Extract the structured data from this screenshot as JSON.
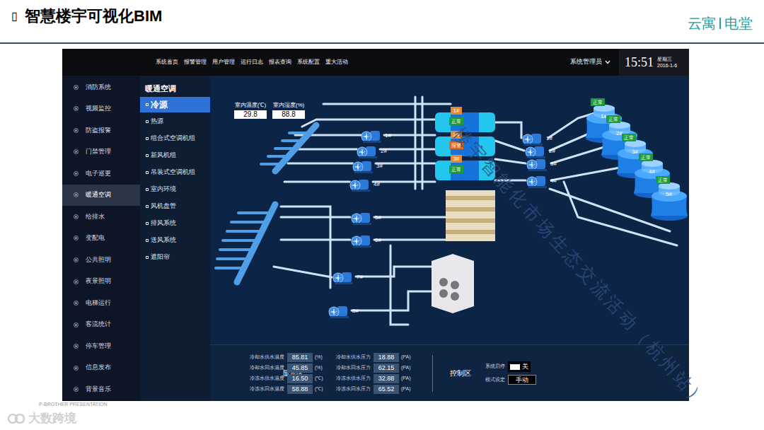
{
  "slide": {
    "title_icon": "▯",
    "title": "智慧楼宇可视化BIM",
    "brand": [
      "云寓",
      "电堂"
    ],
    "credit": "P-BROTHER PRESENTATION",
    "logo_text": "大数跨境",
    "watermark": "楼宇智能化市场生态交流活动（杭州站）"
  },
  "app": {
    "nav": [
      "系统首页",
      "报警管理",
      "用户管理",
      "运行日志",
      "报表查询",
      "系统配置",
      "重大活动"
    ],
    "user": "系统管理员",
    "clock": {
      "time": "15:51",
      "weekday": "星期三",
      "date": "2016-1-6"
    },
    "sidebar": [
      {
        "label": "消防系统",
        "selected": false
      },
      {
        "label": "视频监控",
        "selected": false
      },
      {
        "label": "防盗报警",
        "selected": false
      },
      {
        "label": "门禁管理",
        "selected": false
      },
      {
        "label": "电子巡更",
        "selected": false
      },
      {
        "label": "暖通空调",
        "selected": true
      },
      {
        "label": "给排水",
        "selected": false
      },
      {
        "label": "变配电",
        "selected": false
      },
      {
        "label": "公共照明",
        "selected": false
      },
      {
        "label": "夜景照明",
        "selected": false
      },
      {
        "label": "电梯运行",
        "selected": false
      },
      {
        "label": "客流统计",
        "selected": false
      },
      {
        "label": "停车管理",
        "selected": false
      },
      {
        "label": "信息发布",
        "selected": false
      },
      {
        "label": "背景音乐",
        "selected": false
      }
    ],
    "submenu": {
      "title": "暖通空调",
      "items": [
        {
          "label": "冷源",
          "selected": true
        },
        {
          "label": "热源",
          "selected": false
        },
        {
          "label": "组合式空调机组",
          "selected": false
        },
        {
          "label": "新风机组",
          "selected": false
        },
        {
          "label": "吊装式空调机组",
          "selected": false
        },
        {
          "label": "室内环境",
          "selected": false
        },
        {
          "label": "风机盘管",
          "selected": false
        },
        {
          "label": "排风系统",
          "selected": false
        },
        {
          "label": "送风系统",
          "selected": false
        },
        {
          "label": "遮阳帘",
          "selected": false
        }
      ]
    },
    "indoor": [
      {
        "label": "室内温度(℃)",
        "value": "29.8"
      },
      {
        "label": "室内湿度(%)",
        "value": "88.8"
      }
    ],
    "left_pumps": [
      "1#",
      "2#",
      "3#",
      "4#",
      "5#",
      "6#",
      "7#",
      "8#"
    ],
    "right_pumps": [
      "1#",
      "2#",
      "3#",
      "4#"
    ],
    "chillers": [
      {
        "label": "1#",
        "status": "正常",
        "alarm": false
      },
      {
        "label": "2#",
        "status": "报警",
        "alarm": true
      },
      {
        "label": "3#",
        "status": "正常",
        "alarm": false
      }
    ],
    "towers": [
      {
        "label": "1#",
        "status": "正常"
      },
      {
        "label": "2#",
        "status": "正常"
      },
      {
        "label": "3#",
        "status": "正常"
      },
      {
        "label": "4#",
        "status": "正常"
      },
      {
        "label": "5#",
        "status": "正常"
      }
    ],
    "display": {
      "title": "显示区",
      "columns": [
        [
          {
            "label": "冷却水供水温度",
            "value": "85.81",
            "unit": "(%)"
          },
          {
            "label": "冷却水回水温度",
            "value": "45.85",
            "unit": "(%)"
          },
          {
            "label": "冷冻水供水温度",
            "value": "16.50",
            "unit": "(℃)"
          },
          {
            "label": "冷冻水回水温度",
            "value": "58.88",
            "unit": "(℃)"
          }
        ],
        [
          {
            "label": "冷却水供水压力",
            "value": "18.88",
            "unit": "(PA)"
          },
          {
            "label": "冷却水回水压力",
            "value": "62.15",
            "unit": "(PA)"
          },
          {
            "label": "冷冻水供水压力",
            "value": "32.88",
            "unit": "(PA)"
          },
          {
            "label": "冷冻水回水压力",
            "value": "65.52",
            "unit": "(PA)"
          }
        ]
      ]
    },
    "control": {
      "title": "控制区",
      "rows": [
        {
          "label": "系统启停",
          "value": "关",
          "kind": "switch",
          "on": false
        },
        {
          "label": "模式设定",
          "value": "手动",
          "kind": "select",
          "on": false
        }
      ]
    }
  }
}
